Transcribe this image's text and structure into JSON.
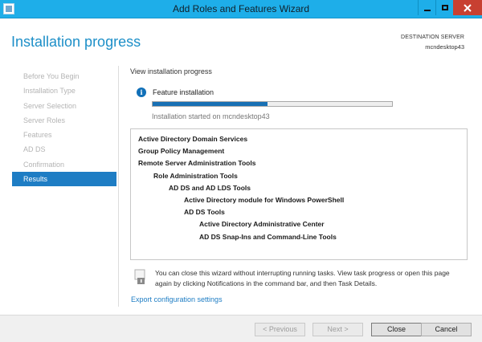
{
  "window": {
    "title": "Add Roles and Features Wizard"
  },
  "header": {
    "page_title": "Installation progress",
    "destination_label": "DESTINATION SERVER",
    "destination_server": "mcndesktop43"
  },
  "nav": {
    "items": [
      {
        "label": "Before You Begin",
        "active": false
      },
      {
        "label": "Installation Type",
        "active": false
      },
      {
        "label": "Server Selection",
        "active": false
      },
      {
        "label": "Server Roles",
        "active": false
      },
      {
        "label": "Features",
        "active": false
      },
      {
        "label": "AD DS",
        "active": false
      },
      {
        "label": "Confirmation",
        "active": false
      },
      {
        "label": "Results",
        "active": true
      }
    ]
  },
  "progress": {
    "view_label": "View installation progress",
    "feature_label": "Feature installation",
    "fraction": 0.48,
    "status_text": "Installation started on mcndesktop43"
  },
  "features": [
    {
      "label": "Active Directory Domain Services",
      "level": 0
    },
    {
      "label": "Group Policy Management",
      "level": 0
    },
    {
      "label": "Remote Server Administration Tools",
      "level": 0
    },
    {
      "label": "Role Administration Tools",
      "level": 1
    },
    {
      "label": "AD DS and AD LDS Tools",
      "level": 2
    },
    {
      "label": "Active Directory module for Windows PowerShell",
      "level": 3
    },
    {
      "label": "AD DS Tools",
      "level": 3
    },
    {
      "label": "Active Directory Administrative Center",
      "level": 4
    },
    {
      "label": "AD DS Snap-Ins and Command-Line Tools",
      "level": 4
    }
  ],
  "note": {
    "text": "You can close this wizard without interrupting running tasks. View task progress or open this page again by clicking Notifications in the command bar, and then Task Details."
  },
  "export_link": "Export configuration settings",
  "buttons": {
    "previous": "< Previous",
    "next": "Next >",
    "close": "Close",
    "cancel": "Cancel"
  },
  "colors": {
    "titlebar": "#1eaee9",
    "accent": "#1d8fc8",
    "nav_active": "#1e7dc4",
    "progress_fill": "#1870b4"
  }
}
